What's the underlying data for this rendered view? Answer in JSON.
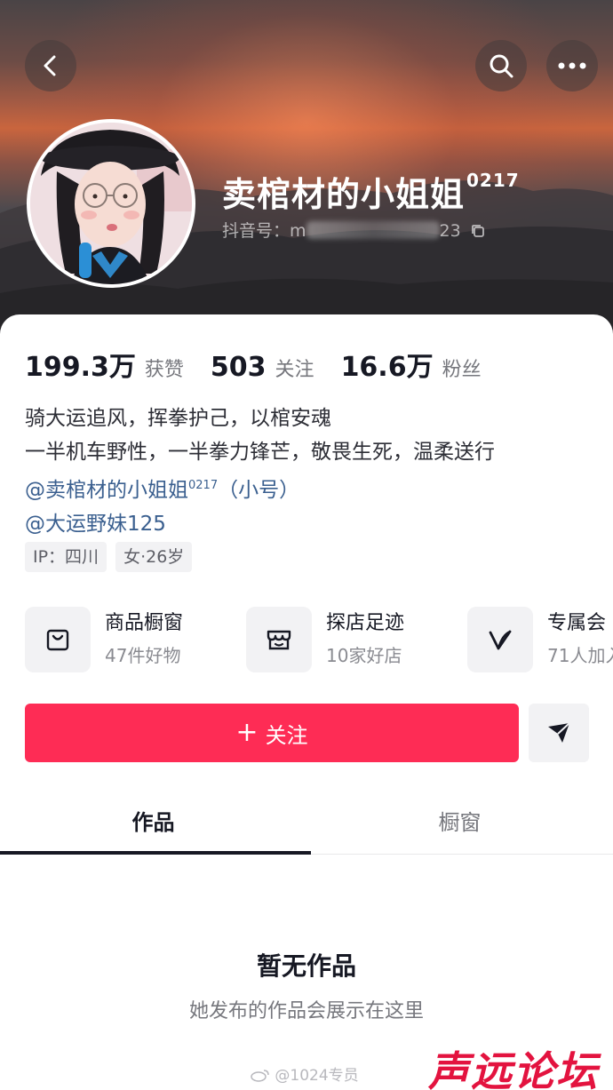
{
  "header": {
    "back_icon": "chevron-left-icon",
    "search_icon": "search-icon",
    "more_icon": "more-dots-icon"
  },
  "profile": {
    "nickname": "卖棺材的小姐姐",
    "nickname_suffix": "0217",
    "douyin_id_label": "抖音号：",
    "douyin_id_prefix": "m",
    "douyin_id_suffix": "23"
  },
  "stats": [
    {
      "value": "199.3万",
      "label": "获赞"
    },
    {
      "value": "503",
      "label": "关注"
    },
    {
      "value": "16.6万",
      "label": "粉丝"
    }
  ],
  "bio": {
    "line1": "骑大运追风，挥拳护己，以棺安魂",
    "line2": "一半机车野性，一半拳力锋芒，敬畏生死，温柔送行",
    "link1_prefix": "@卖棺材的小姐姐",
    "link1_sup": "0217",
    "link1_suffix": "（小号）",
    "link2": "@大运野妹125"
  },
  "tags": [
    "IP：四川",
    "女·26岁"
  ],
  "features": [
    {
      "icon": "shopping-bag-icon",
      "title": "商品橱窗",
      "sub": "47件好物"
    },
    {
      "icon": "store-icon",
      "title": "探店足迹",
      "sub": "10家好店"
    },
    {
      "icon": "v-badge-icon",
      "title": "专属会",
      "sub": "71人加入"
    }
  ],
  "actions": {
    "follow_plus": "+",
    "follow_label": "关注",
    "dm_icon": "send-message-icon"
  },
  "tabs": [
    "作品",
    "橱窗"
  ],
  "empty": {
    "title": "暂无作品",
    "subtitle": "她发布的作品会展示在这里"
  },
  "watermark": "@1024专员",
  "site_logo": "声远论坛",
  "colors": {
    "accent": "#fe2c55",
    "link": "#3a5f8f",
    "site_logo": "#e3133f"
  }
}
